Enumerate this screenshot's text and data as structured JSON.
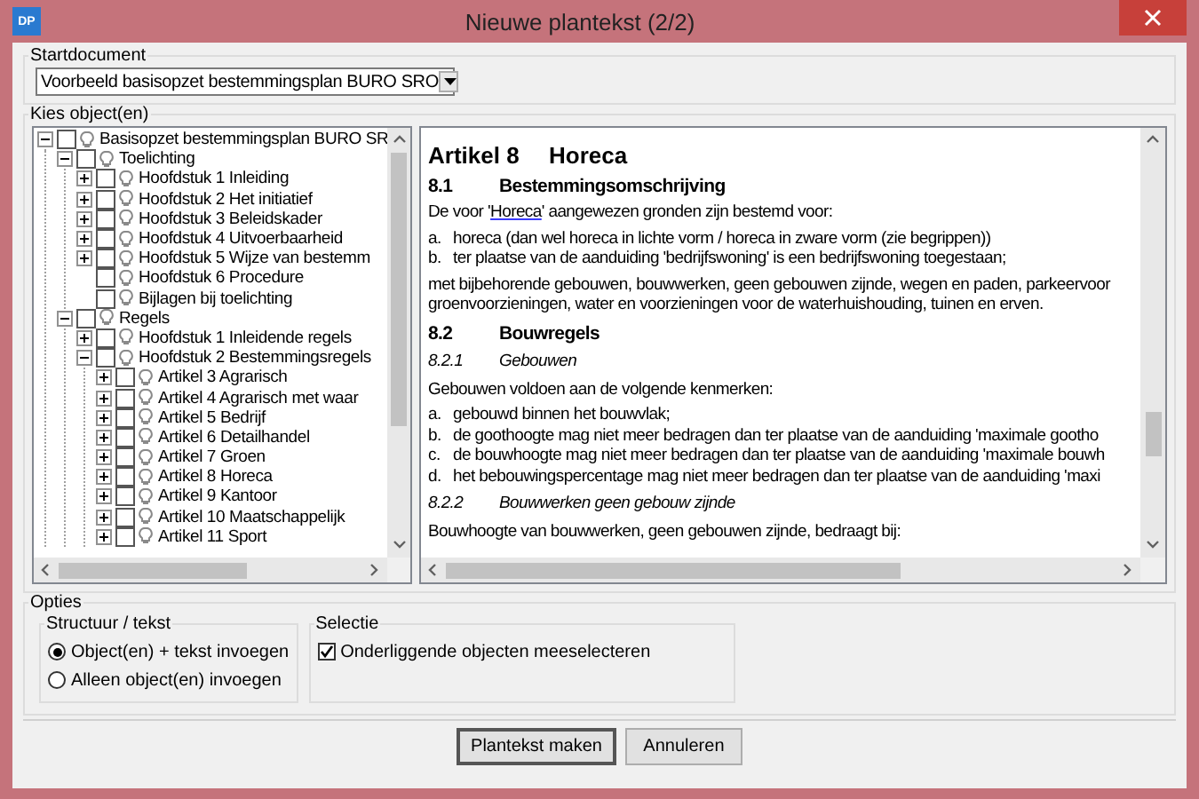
{
  "window": {
    "title": "Nieuwe plantekst (2/2)",
    "app_badge": "DP"
  },
  "startdocument": {
    "label": "Startdocument",
    "value": "Voorbeeld basisopzet bestemmingsplan BURO SRO"
  },
  "objects": {
    "label": "Kies object(en)",
    "tree": [
      {
        "label": "Basisopzet bestemmingsplan BURO SR",
        "kind": "branch",
        "expanded": true,
        "checked": false,
        "children": [
          {
            "label": "Toelichting",
            "kind": "branch",
            "expanded": true,
            "checked": false,
            "children": [
              {
                "label": "Hoofdstuk 1 Inleiding",
                "kind": "branch",
                "expanded": false,
                "checked": false
              },
              {
                "label": "Hoofdstuk 2 Het initiatief",
                "kind": "branch",
                "expanded": false,
                "checked": false
              },
              {
                "label": "Hoofdstuk 3 Beleidskader",
                "kind": "branch",
                "expanded": false,
                "checked": false
              },
              {
                "label": "Hoofdstuk 4 Uitvoerbaarheid",
                "kind": "branch",
                "expanded": false,
                "checked": false
              },
              {
                "label": "Hoofdstuk 5 Wijze van bestemm",
                "kind": "branch",
                "expanded": false,
                "checked": false
              },
              {
                "label": "Hoofdstuk 6 Procedure",
                "kind": "leaf",
                "checked": false
              },
              {
                "label": "Bijlagen bij toelichting",
                "kind": "leaf",
                "checked": false
              }
            ]
          },
          {
            "label": "Regels",
            "kind": "branch",
            "expanded": true,
            "checked": false,
            "children": [
              {
                "label": "Hoofdstuk 1 Inleidende regels",
                "kind": "branch",
                "expanded": false,
                "checked": false
              },
              {
                "label": "Hoofdstuk 2 Bestemmingsregels",
                "kind": "branch",
                "expanded": true,
                "checked": false,
                "children": [
                  {
                    "label": "Artikel 3 Agrarisch",
                    "kind": "branch",
                    "expanded": false,
                    "checked": false
                  },
                  {
                    "label": "Artikel 4 Agrarisch met waar",
                    "kind": "branch",
                    "expanded": false,
                    "checked": false
                  },
                  {
                    "label": "Artikel 5 Bedrijf",
                    "kind": "branch",
                    "expanded": false,
                    "checked": false
                  },
                  {
                    "label": "Artikel 6 Detailhandel",
                    "kind": "branch",
                    "expanded": false,
                    "checked": false
                  },
                  {
                    "label": "Artikel 7 Groen",
                    "kind": "branch",
                    "expanded": false,
                    "checked": false
                  },
                  {
                    "label": "Artikel 8 Horeca",
                    "kind": "branch",
                    "expanded": false,
                    "checked": false
                  },
                  {
                    "label": "Artikel 9 Kantoor",
                    "kind": "branch",
                    "expanded": false,
                    "checked": false
                  },
                  {
                    "label": "Artikel 10 Maatschappelijk",
                    "kind": "branch",
                    "expanded": false,
                    "checked": false
                  },
                  {
                    "label": "Artikel 11 Sport",
                    "kind": "branch",
                    "expanded": false,
                    "checked": false
                  }
                ]
              }
            ]
          }
        ]
      }
    ]
  },
  "preview": {
    "blocks": [
      {
        "kind": "h1",
        "num": "Artikel 8",
        "title": "Horeca"
      },
      {
        "kind": "h2",
        "num": "8.1",
        "title": "Bestemmingsomschrijving"
      },
      {
        "kind": "link_para",
        "before": "De voor '",
        "link": "Horeca",
        "after": "' aangewezen gronden zijn bestemd voor:"
      },
      {
        "kind": "list",
        "items": [
          {
            "marker": "a.",
            "text": "horeca (dan wel horeca in lichte vorm / horeca in zware vorm (zie begrippen))"
          },
          {
            "marker": "b.",
            "text": "ter plaatse van de aanduiding 'bedrijfswoning' is een bedrijfswoning toegestaan;"
          }
        ]
      },
      {
        "kind": "para",
        "lines": [
          "met bijbehorende gebouwen, bouwwerken, geen gebouwen zijnde, wegen en paden, parkeervoor",
          "groenvoorzieningen, water en voorzieningen voor de waterhuishouding, tuinen en erven."
        ]
      },
      {
        "kind": "h2",
        "num": "8.2",
        "title": "Bouwregels"
      },
      {
        "kind": "h3",
        "num": "8.2.1",
        "title": "Gebouwen"
      },
      {
        "kind": "para",
        "lines": [
          "Gebouwen voldoen aan de volgende kenmerken:"
        ]
      },
      {
        "kind": "list",
        "items": [
          {
            "marker": "a.",
            "text": "gebouwd binnen het bouwvlak;"
          },
          {
            "marker": "b.",
            "text": "de goothoogte mag niet meer bedragen dan ter plaatse van de aanduiding 'maximale gootho"
          },
          {
            "marker": "c.",
            "text": "de bouwhoogte mag niet meer bedragen dan ter plaatse van de aanduiding 'maximale bouwh"
          },
          {
            "marker": "d.",
            "text": "het bebouwingspercentage mag niet meer bedragen dan ter plaatse van de aanduiding 'maxi"
          }
        ]
      },
      {
        "kind": "h3",
        "num": "8.2.2",
        "title": "Bouwwerken geen gebouw zijnde"
      },
      {
        "kind": "para",
        "lines": [
          "Bouwhoogte van bouwwerken, geen gebouwen zijnde, bedraagt bij:"
        ]
      }
    ]
  },
  "options": {
    "label": "Opties",
    "structure": {
      "label": "Structuur / tekst",
      "radios": [
        {
          "label": "Object(en) + tekst invoegen",
          "selected": true
        },
        {
          "label": "Alleen object(en) invoegen",
          "selected": false
        }
      ]
    },
    "selection": {
      "label": "Selectie",
      "checkboxes": [
        {
          "label": "Onderliggende objecten meeselecteren",
          "checked": true
        }
      ]
    }
  },
  "buttons": [
    {
      "label": "Plantekst maken",
      "default": true
    },
    {
      "label": "Annuleren",
      "default": false
    }
  ]
}
